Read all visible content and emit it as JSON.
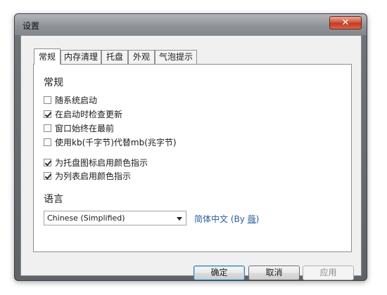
{
  "window": {
    "title": "设置",
    "close_glyph": "✕"
  },
  "tabs": [
    {
      "label": "常规",
      "active": true
    },
    {
      "label": "内存清理",
      "active": false
    },
    {
      "label": "托盘",
      "active": false
    },
    {
      "label": "外观",
      "active": false
    },
    {
      "label": "气泡提示",
      "active": false
    }
  ],
  "general": {
    "section_title": "常规",
    "options": [
      {
        "label": "随系统启动",
        "checked": false
      },
      {
        "label": "在启动时检查更新",
        "checked": true
      },
      {
        "label": "窗口始终在最前",
        "checked": false
      },
      {
        "label": "使用kb(千字节)代替mb(兆字节)",
        "checked": false
      },
      {
        "label": "为托盘图标启用颜色指示",
        "checked": true
      },
      {
        "label": "为列表启用颜色指示",
        "checked": true
      }
    ]
  },
  "language": {
    "section_title": "语言",
    "selected": "Chinese (Simplified)",
    "native_name": "简体中文 (By ",
    "author": "薇",
    "suffix": ")"
  },
  "buttons": {
    "ok": "确定",
    "cancel": "取消",
    "apply": "应用"
  },
  "colors": {
    "link": "#2b5c9e",
    "default_button_border": "#3c7fb1"
  }
}
